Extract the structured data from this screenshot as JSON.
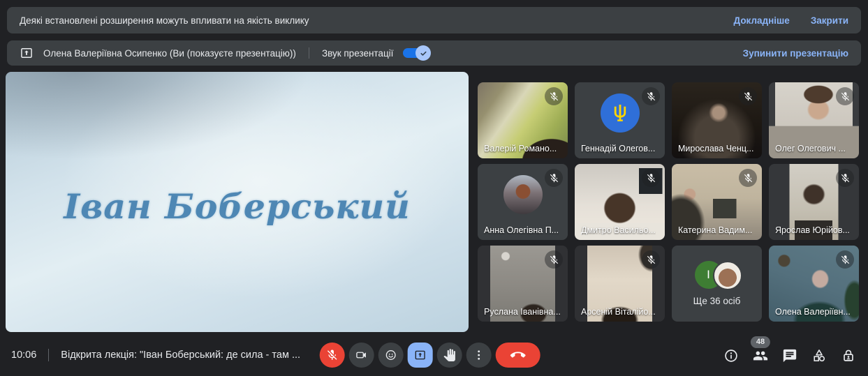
{
  "banner": {
    "text": "Деякі встановлені розширення можуть впливати на якість виклику",
    "details_label": "Докладніше",
    "close_label": "Закрити"
  },
  "presentation_bar": {
    "presenter_label": "Олена Валеріївна Осипенко (Ви (показуєте презентацію))",
    "sound_toggle_label": "Звук презентації",
    "sound_toggle_on": true,
    "stop_label": "Зупинити презентацію"
  },
  "stage": {
    "slide_text": "Іван Боберський"
  },
  "participants": [
    {
      "name": "Валерій Романо...",
      "muted": true,
      "kind": "video"
    },
    {
      "name": "Геннадій Олегов...",
      "muted": true,
      "kind": "avatar-trident"
    },
    {
      "name": "Мирослава Ченц...",
      "muted": true,
      "kind": "video"
    },
    {
      "name": "Олег Олегович ...",
      "muted": true,
      "kind": "video"
    },
    {
      "name": "Анна Олегівна П...",
      "muted": true,
      "kind": "avatar-photo"
    },
    {
      "name": "Дмитро Васильо...",
      "muted": true,
      "kind": "video"
    },
    {
      "name": "Катерина Вадим...",
      "muted": true,
      "kind": "video"
    },
    {
      "name": "Ярослав Юрійов...",
      "muted": true,
      "kind": "video"
    },
    {
      "name": "Руслана Іванівна...",
      "muted": true,
      "kind": "video"
    },
    {
      "name": "Арсеній Віталійо...",
      "muted": true,
      "kind": "video"
    },
    {
      "name": "Олена Валеріївн...",
      "muted": true,
      "kind": "video"
    }
  ],
  "overflow_tile": {
    "label": "Ще 36 осіб",
    "initial": "І"
  },
  "bottom_bar": {
    "time": "10:06",
    "meeting_title": "Відкрита лекція: \"Іван Боберський: де сила - там ...",
    "participants_badge": "48",
    "controls": [
      "microphone-muted",
      "camera",
      "reactions",
      "present-screen",
      "raise-hand",
      "more-options",
      "leave-call"
    ],
    "right_controls": [
      "meeting-details",
      "people",
      "chat",
      "activities",
      "host-controls"
    ]
  },
  "colors": {
    "accent_blue": "#8ab4f8",
    "danger_red": "#ea4335",
    "surface": "#3c4043",
    "background": "#202124",
    "toggle_blue": "#1a73e8",
    "trident_yellow": "#ffd500",
    "trident_circle_blue": "#2f6fd8"
  }
}
